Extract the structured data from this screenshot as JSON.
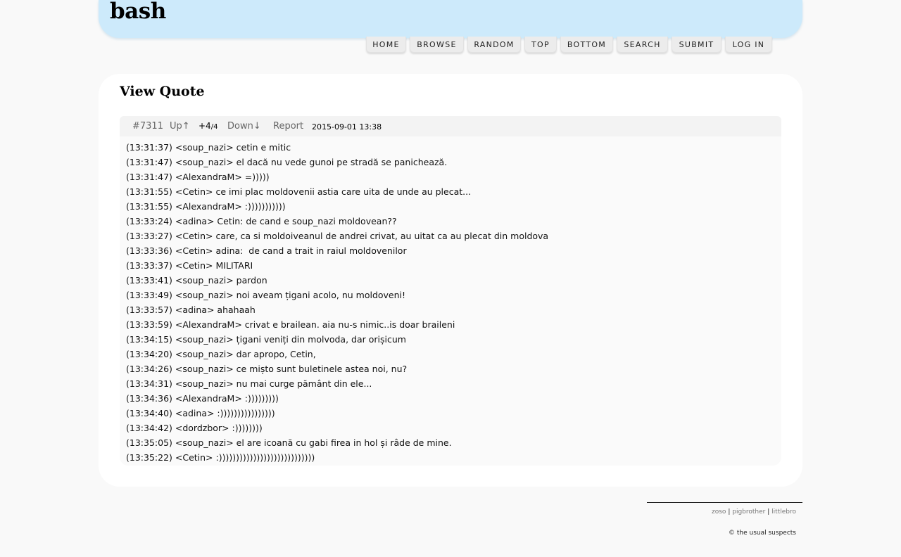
{
  "site": {
    "title": "bash"
  },
  "nav": {
    "items": [
      {
        "label": "HOME"
      },
      {
        "label": "BROWSE"
      },
      {
        "label": "RANDOM"
      },
      {
        "label": "TOP"
      },
      {
        "label": "BOTTOM"
      },
      {
        "label": "SEARCH"
      },
      {
        "label": "SUBMIT"
      },
      {
        "label": "LOG IN"
      }
    ]
  },
  "page": {
    "title": "View Quote"
  },
  "quote": {
    "id": "#7311",
    "up_label": "Up↑",
    "score": "+4",
    "score_sep": "/",
    "votes": "4",
    "down_label": "Down↓",
    "report_label": "Report",
    "date": "2015-09-01 13:38",
    "lines": [
      "(13:31:37) <soup_nazi> cetin e mitic",
      "(13:31:47) <soup_nazi> el dacă nu vede gunoi pe stradă se panichează.",
      "(13:31:47) <AlexandraM> =)))))",
      "(13:31:55) <Cetin> ce imi plac moldovenii astia care uita de unde au plecat...",
      "(13:31:55) <AlexandraM> :)))))))))))",
      "(13:33:24) <adina> Cetin: de cand e soup_nazi moldovean??",
      "(13:33:27) <Cetin> care, ca si moldoiveanul de andrei crivat, au uitat ca au plecat din moldova",
      "(13:33:36) <Cetin> adina:  de cand a trait in raiul moldovenilor",
      "(13:33:37) <Cetin> MILITARI",
      "(13:33:41) <soup_nazi> pardon",
      "(13:33:49) <soup_nazi> noi aveam țigani acolo, nu moldoveni!",
      "(13:33:57) <adina> ahahaah",
      "(13:33:59) <AlexandraM> crivat e brailean. aia nu-s nimic..is doar braileni",
      "(13:34:15) <soup_nazi> țigani veniți din molvoda, dar orișicum",
      "(13:34:20) <soup_nazi> dar apropo, Cetin,",
      "(13:34:26) <soup_nazi> ce mișto sunt buletinele astea noi, nu?",
      "(13:34:31) <soup_nazi> nu mai curge pământ din ele...",
      "(13:34:36) <AlexandraM> :)))))))))",
      "(13:34:40) <adina> :))))))))))))))))",
      "(13:34:42) <dordzbor> :))))))))",
      "(13:35:05) <soup_nazi> el are icoană cu gabi firea in hol și râde de mine.",
      "(13:35:22) <Cetin> :))))))))))))))))))))))))))))"
    ]
  },
  "footer": {
    "links": [
      "zoso",
      "pigbrother",
      "littlebro"
    ],
    "separator": "|",
    "copyright": "© the usual suspects"
  }
}
